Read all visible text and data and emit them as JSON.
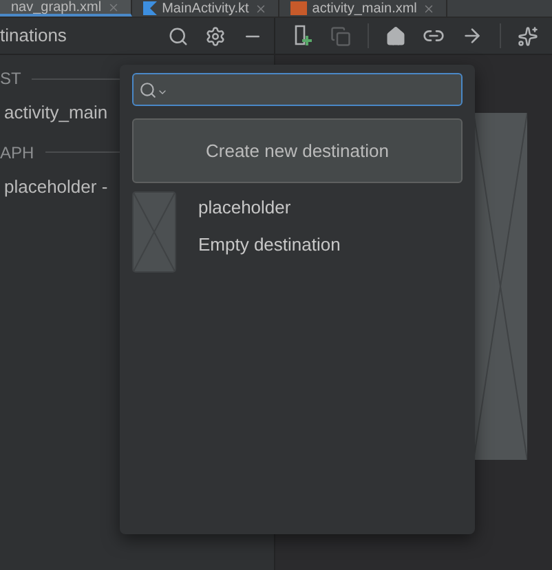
{
  "tabs": [
    {
      "label": "nav_graph.xml",
      "selected": true,
      "kind": "navigation"
    },
    {
      "label": "MainActivity.kt",
      "selected": false,
      "kind": "kotlin"
    },
    {
      "label": "activity_main.xml",
      "selected": false,
      "kind": "layout"
    }
  ],
  "destinations_panel": {
    "title": "tinations",
    "sections": [
      {
        "header": "ST",
        "items": [
          "activity_main"
        ]
      },
      {
        "header": "APH",
        "items": [
          "placeholder -"
        ]
      }
    ]
  },
  "toolbar": [
    {
      "kind": "new-destination",
      "disabled": false
    },
    {
      "kind": "copy",
      "disabled": true
    },
    {
      "kind": "home",
      "disabled": false
    },
    {
      "kind": "link",
      "disabled": false
    },
    {
      "kind": "action",
      "disabled": false
    },
    {
      "kind": "auto-arrange",
      "disabled": false
    }
  ],
  "popup": {
    "create_button": "Create new destination",
    "items": [
      {
        "title": "placeholder",
        "subtitle": "Empty destination"
      }
    ]
  }
}
